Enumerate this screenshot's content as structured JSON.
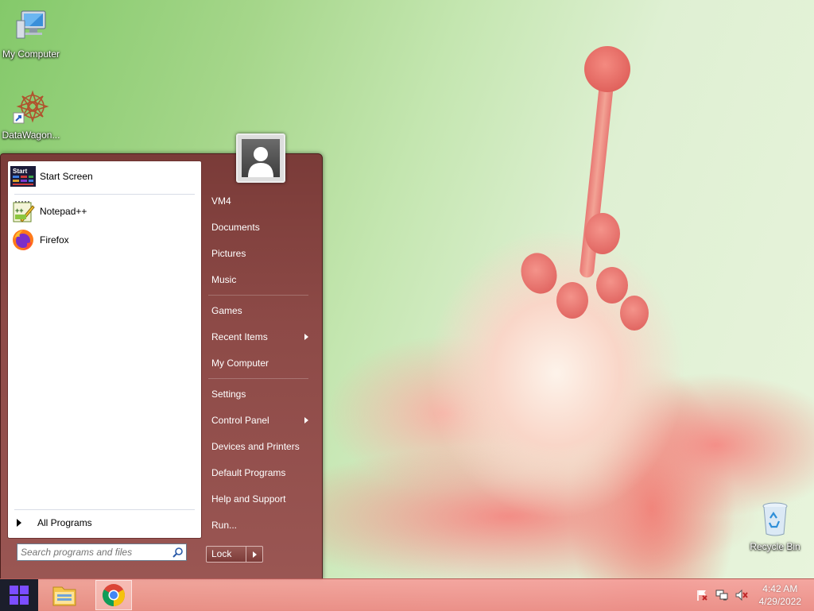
{
  "desktop": {
    "icons": [
      {
        "label": "My Computer",
        "icon": "computer-icon"
      },
      {
        "label": "DataWagon...",
        "icon": "datawagon-icon"
      },
      {
        "label": "Recycle Bin",
        "icon": "recycle-bin-icon"
      }
    ]
  },
  "start_menu": {
    "pinned": [
      {
        "label": "Start Screen",
        "icon": "start-screen-icon",
        "icon_text": "Start"
      },
      {
        "label": "Notepad++",
        "icon": "notepadpp-icon"
      },
      {
        "label": "Firefox",
        "icon": "firefox-icon"
      }
    ],
    "all_programs_label": "All Programs",
    "search_placeholder": "Search programs and files",
    "right_items": [
      {
        "label": "VM4"
      },
      {
        "label": "Documents"
      },
      {
        "label": "Pictures"
      },
      {
        "label": "Music"
      },
      {
        "label": "Games"
      },
      {
        "label": "Recent Items",
        "submenu": true
      },
      {
        "label": "My Computer"
      },
      {
        "label": "Settings"
      },
      {
        "label": "Control Panel",
        "submenu": true
      },
      {
        "label": "Devices and Printers"
      },
      {
        "label": "Default Programs"
      },
      {
        "label": "Help and Support"
      },
      {
        "label": "Run..."
      }
    ],
    "power_button_label": "Lock"
  },
  "taskbar": {
    "start_icon": "windows-logo-icon",
    "buttons": [
      {
        "icon": "file-explorer-icon",
        "active": false
      },
      {
        "icon": "chrome-icon",
        "active": true
      }
    ],
    "tray_icons": [
      "action-center-flag-icon",
      "network-icon",
      "volume-muted-icon"
    ],
    "time": "4:42 AM",
    "date": "4/29/2022"
  },
  "colors": {
    "start_menu_right": "#8d4a47",
    "taskbar": "#ec8882",
    "start_button": "#1b1e2b"
  }
}
